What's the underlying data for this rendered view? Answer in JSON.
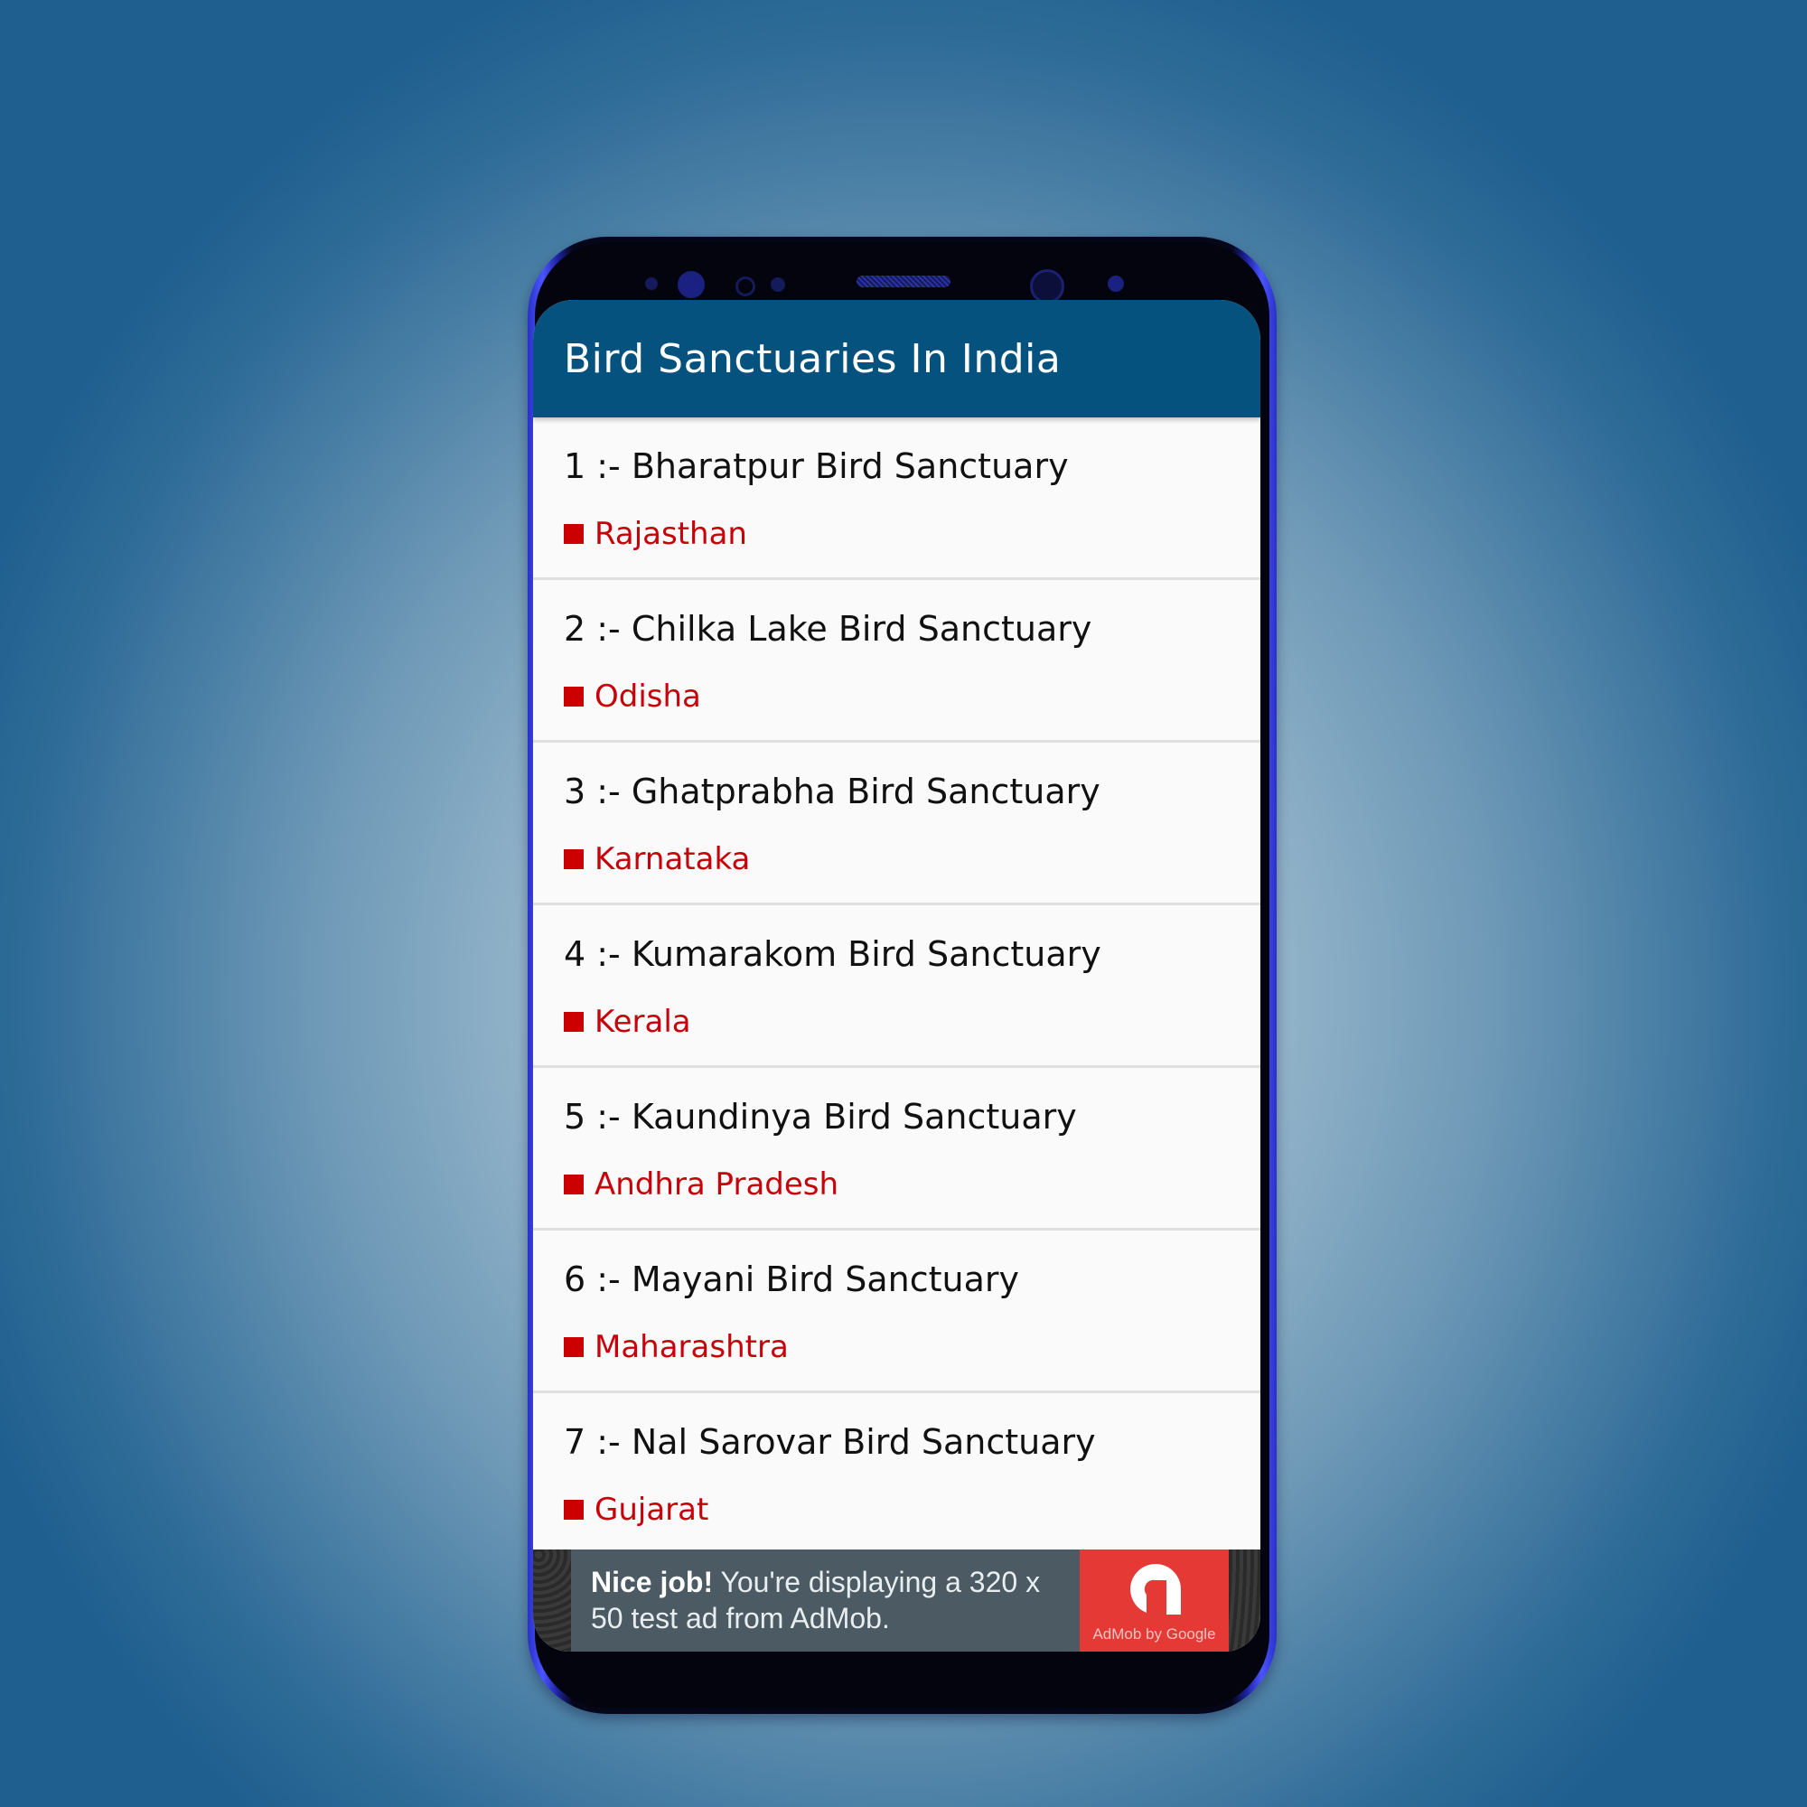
{
  "app": {
    "title": "Bird Sanctuaries In India",
    "header_color": "#05527f",
    "accent_color": "#cc0000"
  },
  "sanctuaries": [
    {
      "name": "1 :- Bharatpur Bird Sanctuary",
      "state": "Rajasthan"
    },
    {
      "name": "2 :- Chilka Lake Bird Sanctuary",
      "state": "Odisha"
    },
    {
      "name": "3 :- Ghatprabha Bird Sanctuary",
      "state": "Karnataka"
    },
    {
      "name": "4 :- Kumarakom Bird Sanctuary",
      "state": "Kerala"
    },
    {
      "name": "5 :- Kaundinya Bird Sanctuary",
      "state": "Andhra Pradesh"
    },
    {
      "name": "6 :- Mayani Bird Sanctuary",
      "state": "Maharashtra"
    },
    {
      "name": "7 :- Nal Sarovar Bird Sanctuary",
      "state": "Gujarat"
    }
  ],
  "ad": {
    "headline": "Nice job!",
    "body": " You're displaying a 320 x 50 test ad from AdMob.",
    "brand": "AdMob by Google",
    "brand_color": "#e53935",
    "panel_color": "#4b5a63"
  }
}
